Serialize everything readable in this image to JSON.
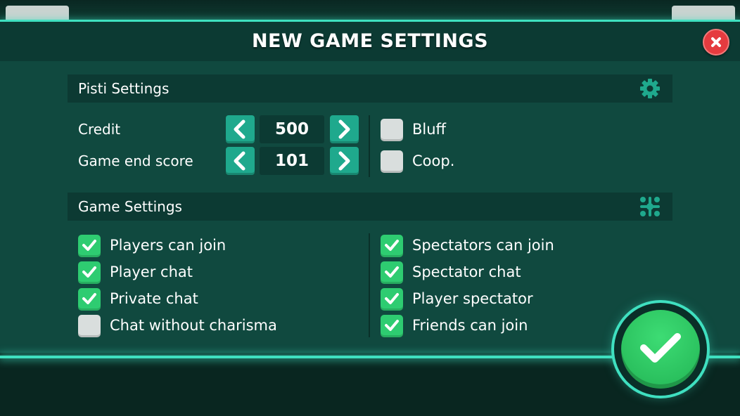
{
  "dialog": {
    "title": "NEW GAME SETTINGS"
  },
  "pisti_settings": {
    "header": "Pisti Settings",
    "credit": {
      "label": "Credit",
      "value": "500"
    },
    "end_score": {
      "label": "Game end score",
      "value": "101"
    },
    "options": [
      {
        "label": "Bluff",
        "checked": false
      },
      {
        "label": "Coop.",
        "checked": false
      }
    ]
  },
  "game_settings": {
    "header": "Game Settings",
    "left": [
      {
        "label": "Players can join",
        "checked": true
      },
      {
        "label": "Player chat",
        "checked": true
      },
      {
        "label": "Private chat",
        "checked": true
      },
      {
        "label": "Chat without charisma",
        "checked": false
      }
    ],
    "right": [
      {
        "label": "Spectators can join",
        "checked": true
      },
      {
        "label": "Spectator chat",
        "checked": true
      },
      {
        "label": "Player spectator",
        "checked": true
      },
      {
        "label": "Friends can join",
        "checked": true
      }
    ]
  },
  "icons": {
    "close": "close-icon",
    "gear": "gear-icon",
    "group": "group-icon",
    "confirm": "checkmark-icon"
  },
  "colors": {
    "panel": "#10493f",
    "header": "#0c3a33",
    "accent": "#3fe0c0",
    "checked": "#2ecc71",
    "stepper": "#1fa98d",
    "close": "#e53b3f"
  }
}
